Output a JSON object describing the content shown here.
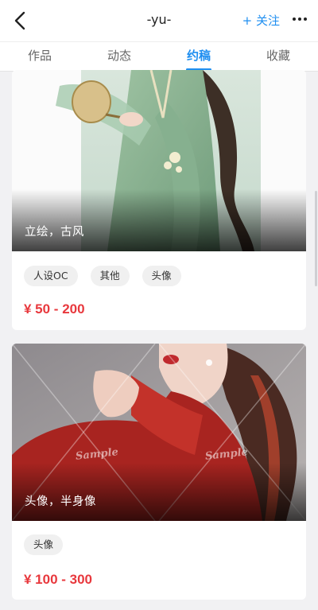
{
  "header": {
    "title": "-yu-",
    "follow_label": "+ 关注",
    "back_icon": "chevron-left-icon",
    "more_icon": "more-horizontal-icon"
  },
  "tabs": [
    {
      "label": "作品",
      "active": false
    },
    {
      "label": "动态",
      "active": false
    },
    {
      "label": "约稿",
      "active": true
    },
    {
      "label": "收藏",
      "active": false
    }
  ],
  "commissions": [
    {
      "caption": "立绘，古风",
      "tags": [
        "人设OC",
        "其他",
        "头像"
      ],
      "price": "¥ 50 - 200"
    },
    {
      "caption": "头像，半身像",
      "tags": [
        "头像"
      ],
      "price": "¥ 100 - 300",
      "watermark": "Sample"
    }
  ],
  "colors": {
    "accent": "#1e8ef0",
    "price": "#e8383d",
    "background": "#f1f1f3"
  }
}
